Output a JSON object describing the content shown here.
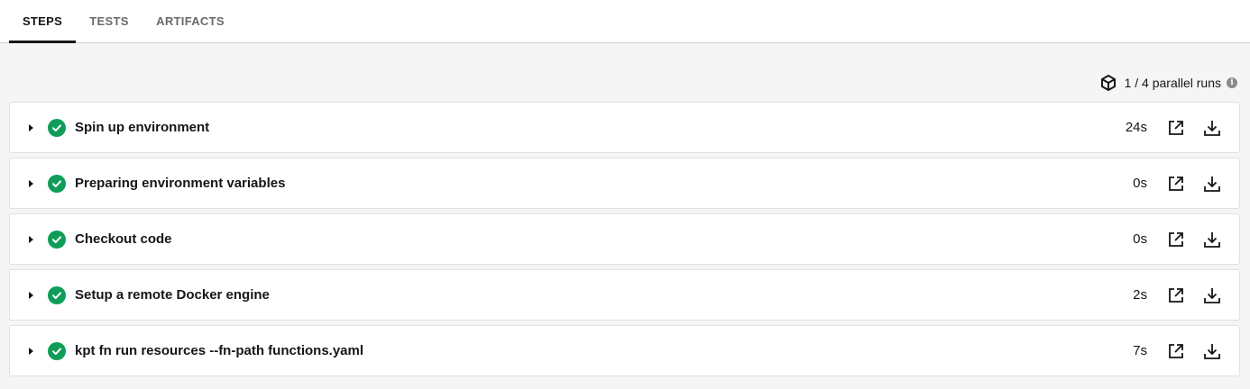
{
  "tabs": [
    {
      "label": "STEPS",
      "active": true
    },
    {
      "label": "TESTS",
      "active": false
    },
    {
      "label": "ARTIFACTS",
      "active": false
    }
  ],
  "parallel_runs": {
    "text": "1 / 4 parallel runs",
    "icon": "box-icon",
    "info_icon": "info-icon"
  },
  "steps": [
    {
      "name": "Spin up environment",
      "duration": "24s",
      "status": "success"
    },
    {
      "name": "Preparing environment variables",
      "duration": "0s",
      "status": "success"
    },
    {
      "name": "Checkout code",
      "duration": "0s",
      "status": "success"
    },
    {
      "name": "Setup a remote Docker engine",
      "duration": "2s",
      "status": "success"
    },
    {
      "name": "kpt fn run resources --fn-path functions.yaml",
      "duration": "7s",
      "status": "success"
    }
  ],
  "colors": {
    "success": "#0f9d58",
    "active_tab": "#161616",
    "inactive_tab": "#6a6a6a"
  }
}
